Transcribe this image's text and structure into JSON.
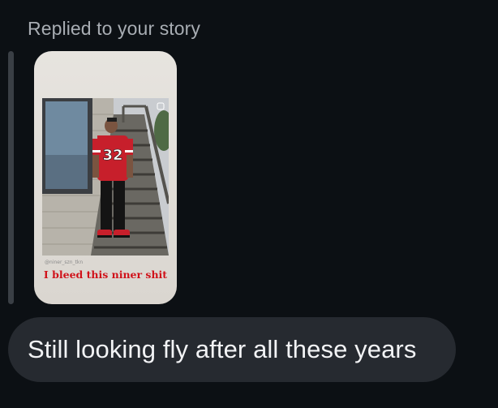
{
  "reply": {
    "label": "Replied to your story"
  },
  "story": {
    "handle": "@niner_szn_tkn",
    "caption": "I bleed this niner shit",
    "jersey_number": "32"
  },
  "message": {
    "text": "Still looking fly after all these years"
  },
  "colors": {
    "background": "#0c1014",
    "bubble": "#262a30",
    "caption_red": "#d0121a"
  }
}
